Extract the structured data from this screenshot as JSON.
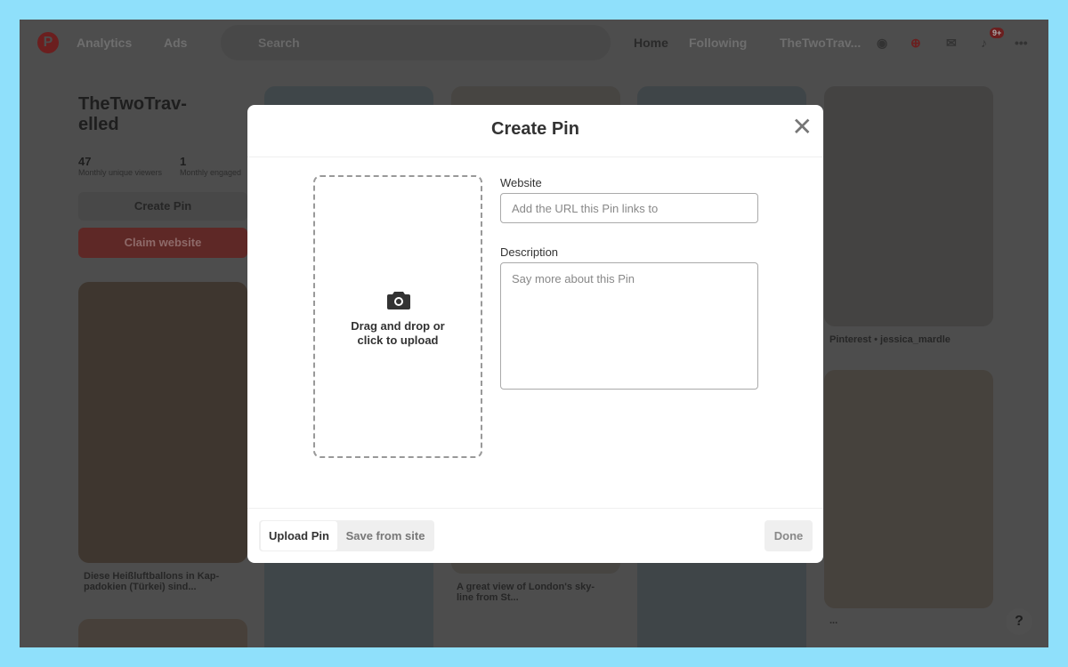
{
  "nav": {
    "analytics": "Analytics",
    "ads": "Ads",
    "search_placeholder": "Search",
    "home": "Home",
    "following": "Following",
    "profile": "TheTwoTrav...",
    "notifications_badge": "9+",
    "more": "•••"
  },
  "profile": {
    "name": "TheTwoTrav-elled",
    "viewers_count": "47",
    "viewers_label": "Monthly unique viewers",
    "engaged_count": "1",
    "engaged_label": "Monthly engaged",
    "create_pin": "Create Pin",
    "claim_website": "Claim website"
  },
  "pins": [
    {
      "caption": "Diese Heißluftballons in Kap-padokien (Türkei) sind..."
    },
    {
      "caption": "A great view of London's sky-line from St..."
    },
    {
      "caption": "Pinterest • jessica_mardle"
    },
    {
      "caption": "..."
    }
  ],
  "help": "?",
  "modal": {
    "title": "Create Pin",
    "upload_text": "Drag and drop or click to upload",
    "website_label": "Website",
    "website_placeholder": "Add the URL this Pin links to",
    "description_label": "Description",
    "description_placeholder": "Say more about this Pin",
    "tab_upload": "Upload Pin",
    "tab_save": "Save from site",
    "done": "Done"
  },
  "colors": {
    "brand": "#e60023",
    "frame": "#8fe0fb"
  }
}
